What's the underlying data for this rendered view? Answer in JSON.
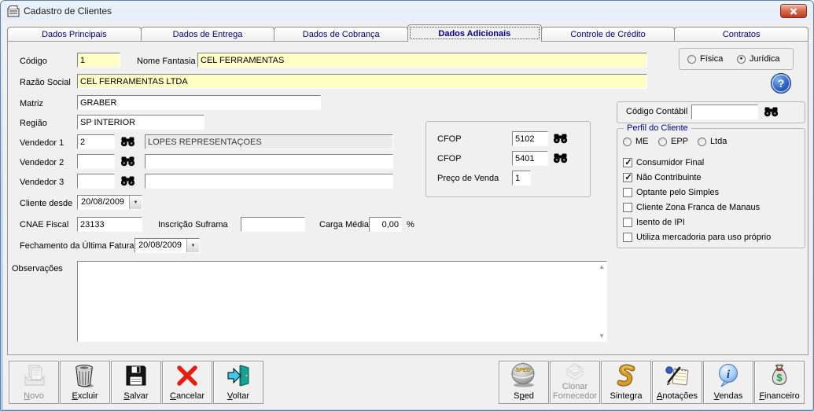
{
  "colors": {
    "field_yellow": "#FFFFC6",
    "tab_text_navy": "#000080",
    "window_bg": "#F0F0F0",
    "close_red": "#BC3A20",
    "help_blue": "#2A5FC4"
  },
  "window": {
    "title": "Cadastro de Clientes"
  },
  "tabs": [
    {
      "label": "Dados Principais"
    },
    {
      "label": "Dados de Entrega"
    },
    {
      "label": "Dados de Cobrança"
    },
    {
      "label": "Dados Adicionais",
      "active": true
    },
    {
      "label": "Controle de Crédito"
    },
    {
      "label": "Contratos"
    }
  ],
  "fields": {
    "codigo": {
      "label": "Código",
      "value": "1"
    },
    "nome_fantasia": {
      "label": "Nome Fantasia",
      "value": "CEL FERRAMENTAS"
    },
    "razao_social": {
      "label": "Razão Social",
      "value": "CEL FERRAMENTAS LTDA"
    },
    "matriz": {
      "label": "Matriz",
      "value": "GRABER"
    },
    "regiao": {
      "label": "Região",
      "value": "SP INTERIOR"
    },
    "vendedor1": {
      "label": "Vendedor 1",
      "code": "2",
      "name": "LOPES REPRESENTAÇOES"
    },
    "vendedor2": {
      "label": "Vendedor 2",
      "code": "",
      "name": ""
    },
    "vendedor3": {
      "label": "Vendedor 3",
      "code": "",
      "name": ""
    },
    "cliente_desde": {
      "label": "Cliente desde",
      "value": "20/08/2009"
    },
    "cnae": {
      "label": "CNAE Fiscal",
      "value": "23133"
    },
    "suframa": {
      "label": "Inscrição Suframa",
      "value": ""
    },
    "carga_media": {
      "label": "Carga Média",
      "value": "0,00",
      "unit": "%"
    },
    "fechamento": {
      "label": "Fechamento da Última Fatura",
      "value": "20/08/2009"
    },
    "observacoes": {
      "label": "Observações",
      "value": ""
    }
  },
  "tipo_pessoa": {
    "fisica": {
      "label": "Física",
      "mark": ""
    },
    "juridica": {
      "label": "Jurídica",
      "mark": "●"
    }
  },
  "cfop": {
    "cfop1_label": "CFOP",
    "cfop1": "5102",
    "cfop2_label": "CFOP",
    "cfop2": "5401",
    "preco_label": "Preço de Venda",
    "preco": "1"
  },
  "contabil": {
    "label": "Código Contábil",
    "value": ""
  },
  "perfil": {
    "title": "Perfil do Cliente",
    "radios": [
      {
        "label": "ME",
        "mark": ""
      },
      {
        "label": "EPP",
        "mark": ""
      },
      {
        "label": "Ltda",
        "mark": ""
      }
    ],
    "checks": [
      {
        "label": "Consumidor Final",
        "mark": "✓"
      },
      {
        "label": "Não Contribuinte",
        "mark": "✓"
      },
      {
        "label": "Optante pelo Simples",
        "mark": ""
      },
      {
        "label": "Cliente Zona Franca de Manaus",
        "mark": ""
      },
      {
        "label": "Isento de IPI",
        "mark": ""
      },
      {
        "label": "Utiliza mercadoria para uso próprio",
        "mark": ""
      }
    ]
  },
  "help": {
    "label": "?"
  },
  "toolbar": {
    "left": [
      {
        "pre": "",
        "key": "N",
        "rest": "ovo",
        "disabled": true
      },
      {
        "pre": "",
        "key": "E",
        "rest": "xcluir"
      },
      {
        "pre": "",
        "key": "S",
        "rest": "alvar"
      },
      {
        "pre": "",
        "key": "C",
        "rest": "ancelar"
      },
      {
        "pre": "",
        "key": "V",
        "rest": "oltar"
      }
    ],
    "right": [
      {
        "pre": "S",
        "key": "p",
        "rest": "ed"
      },
      {
        "pre": "Clonar",
        "key": "",
        "rest": "",
        "line2": "Fornecedor",
        "disabled": true
      },
      {
        "pre": "Sintegra",
        "key": "",
        "rest": ""
      },
      {
        "pre": "",
        "key": "A",
        "rest": "notações"
      },
      {
        "pre": "",
        "key": "V",
        "rest": "endas"
      },
      {
        "pre": "",
        "key": "F",
        "rest": "inanceiro"
      }
    ]
  }
}
